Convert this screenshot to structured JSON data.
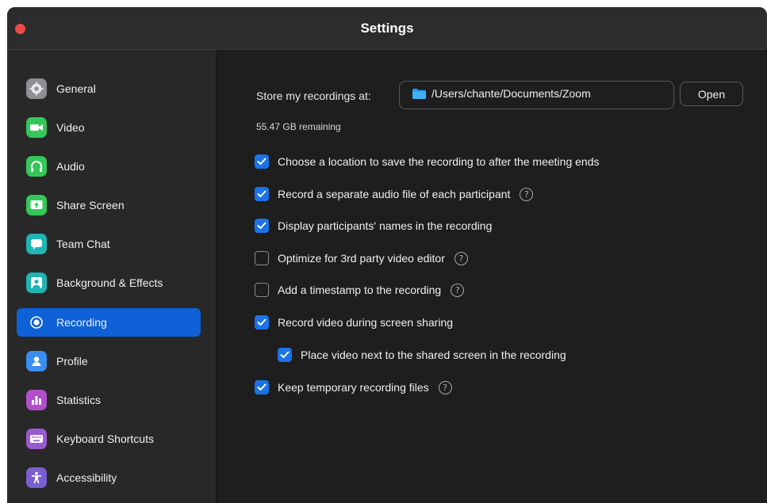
{
  "window": {
    "title": "Settings"
  },
  "sidebar": {
    "items": [
      {
        "label": "General",
        "icon": "gear-icon",
        "color": "#8e8e93"
      },
      {
        "label": "Video",
        "icon": "video-camera-icon",
        "color": "#34c759"
      },
      {
        "label": "Audio",
        "icon": "headphones-icon",
        "color": "#34c759"
      },
      {
        "label": "Share Screen",
        "icon": "share-screen-icon",
        "color": "#34c759"
      },
      {
        "label": "Team Chat",
        "icon": "chat-bubble-icon",
        "color": "#1fb5b5"
      },
      {
        "label": "Background & Effects",
        "icon": "background-icon",
        "color": "#1fb5b5"
      },
      {
        "label": "Recording",
        "icon": "record-icon",
        "color": "#0e61d6",
        "active": true
      },
      {
        "label": "Profile",
        "icon": "person-icon",
        "color": "#3a8ef0"
      },
      {
        "label": "Statistics",
        "icon": "bar-chart-icon",
        "color": "#b04fc9"
      },
      {
        "label": "Keyboard Shortcuts",
        "icon": "keyboard-icon",
        "color": "#9b59d0"
      },
      {
        "label": "Accessibility",
        "icon": "accessibility-icon",
        "color": "#7b5fd0"
      }
    ]
  },
  "recording": {
    "store_label": "Store my recordings at:",
    "path": "/Users/chante/Documents/Zoom",
    "open_label": "Open",
    "remaining": "55.47 GB remaining",
    "options": [
      {
        "label": "Choose a location to save the recording to after the meeting ends",
        "checked": true,
        "help": false
      },
      {
        "label": "Record a separate audio file of each participant",
        "checked": true,
        "help": true
      },
      {
        "label": "Display participants' names in the recording",
        "checked": true,
        "help": false
      },
      {
        "label": "Optimize for 3rd party video editor",
        "checked": false,
        "help": true
      },
      {
        "label": "Add a timestamp to the recording",
        "checked": false,
        "help": true
      },
      {
        "label": "Record video during screen sharing",
        "checked": true,
        "help": false
      },
      {
        "label": "Place video next to the shared screen in the recording",
        "checked": true,
        "help": false,
        "indent": true
      },
      {
        "label": "Keep temporary recording files",
        "checked": true,
        "help": true
      }
    ],
    "help_glyph": "?"
  },
  "colors": {
    "accent": "#1a73e8",
    "active_nav": "#0e61d6",
    "close_button": "#ed4b48"
  }
}
